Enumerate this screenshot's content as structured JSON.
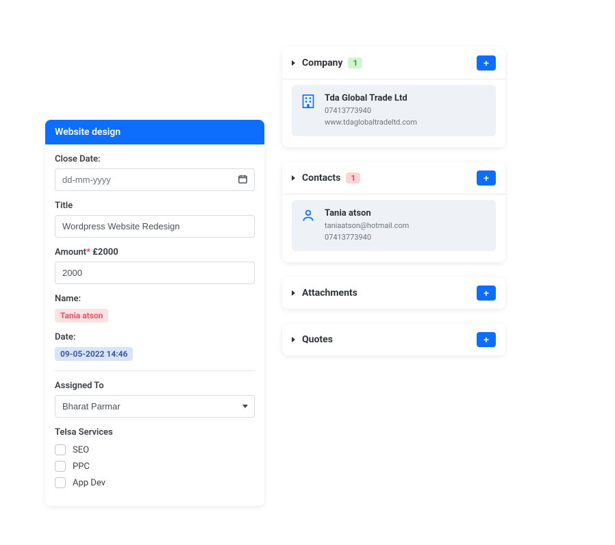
{
  "form": {
    "header": "Website design",
    "closeDate": {
      "label": "Close Date:",
      "placeholder": "dd-mm-yyyy",
      "value": ""
    },
    "title": {
      "label": "Title",
      "value": "Wordpress Website Redesign"
    },
    "amount": {
      "label": "Amount",
      "required": "*",
      "display": "£2000",
      "value": "2000"
    },
    "name": {
      "label": "Name:",
      "value": "Tania atson"
    },
    "date": {
      "label": "Date:",
      "value": "09-05-2022 14:46"
    },
    "assignedTo": {
      "label": "Assigned To",
      "selected": "Bharat Parmar"
    },
    "services": {
      "label": "Telsa Services",
      "items": [
        "SEO",
        "PPC",
        "App Dev"
      ]
    }
  },
  "panels": {
    "company": {
      "title": "Company",
      "count": "1",
      "entity": {
        "name": "Tda Global Trade Ltd",
        "phone": "07413773940",
        "website": "www.tdaglobaltradeltd.com"
      }
    },
    "contacts": {
      "title": "Contacts",
      "count": "1",
      "entity": {
        "name": "Tania atson",
        "email": "taniaatson@hotmail.com",
        "phone": "07413773940"
      }
    },
    "attachments": {
      "title": "Attachments"
    },
    "quotes": {
      "title": "Quotes"
    }
  }
}
